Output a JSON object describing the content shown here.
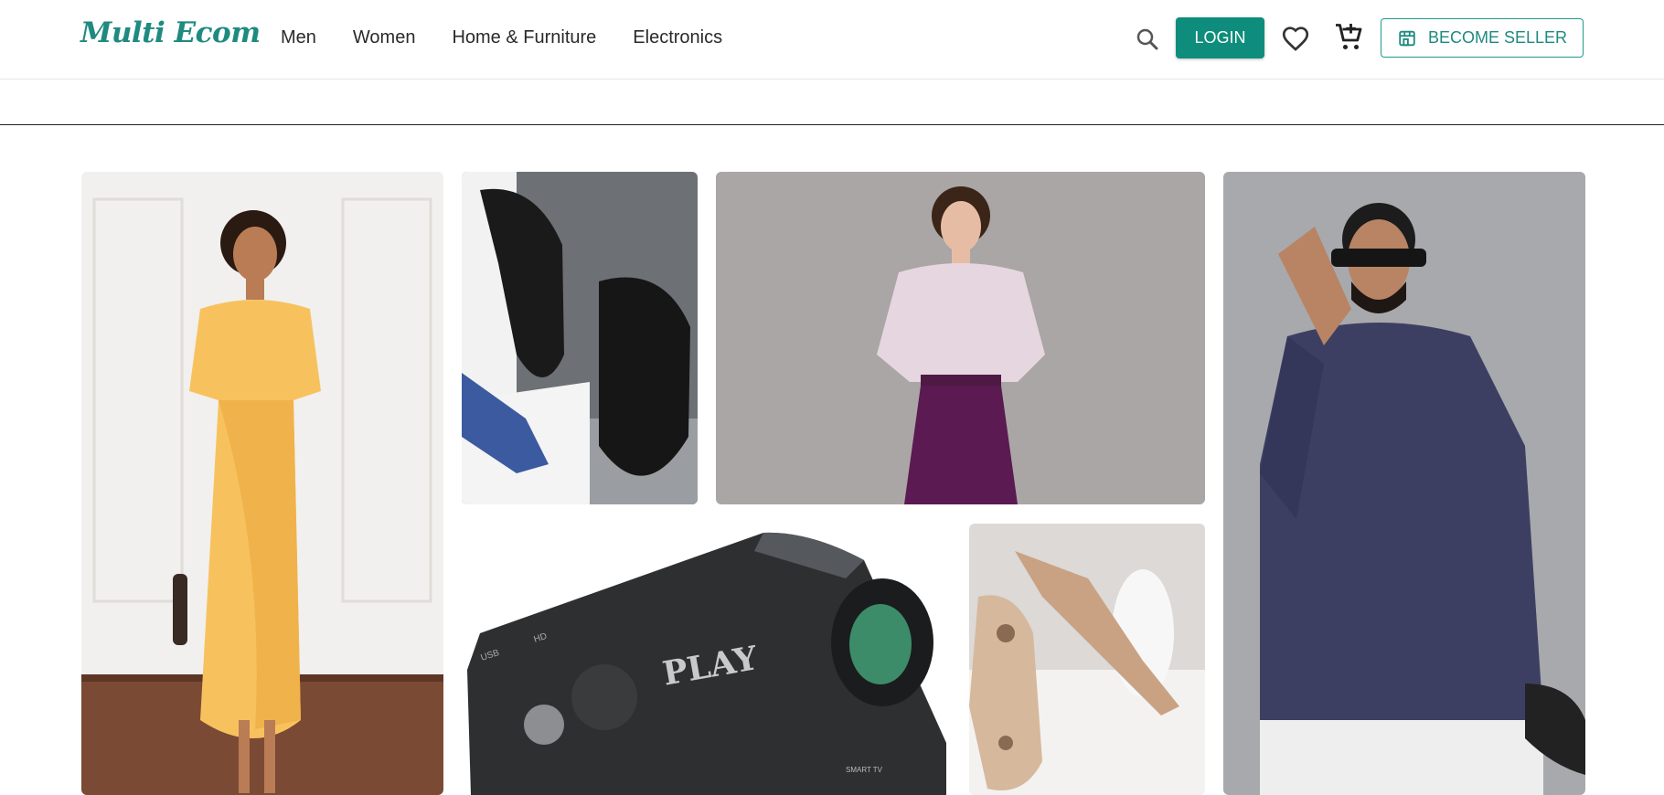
{
  "brand": {
    "logo_text": "Multi Ecom",
    "accent": "#0e8d7c"
  },
  "nav": {
    "items": [
      "Men",
      "Women",
      "Home & Furniture",
      "Electronics"
    ]
  },
  "actions": {
    "login_label": "LOGIN",
    "seller_label": "BECOME SELLER",
    "icons": [
      "search-icon",
      "heart-icon",
      "cart-plus-icon",
      "store-icon"
    ]
  },
  "grid": {
    "tiles": [
      {
        "name": "woman-yellow-dress",
        "text": ""
      },
      {
        "name": "black-formal-shoes",
        "text": ""
      },
      {
        "name": "woman-floral-shirt",
        "text": ""
      },
      {
        "name": "man-kurta",
        "text": ""
      },
      {
        "name": "projector",
        "text": "PLAY",
        "small_text": [
          "USB",
          "HD",
          "SMART TV"
        ]
      },
      {
        "name": "beige-sandals",
        "text": ""
      }
    ]
  }
}
